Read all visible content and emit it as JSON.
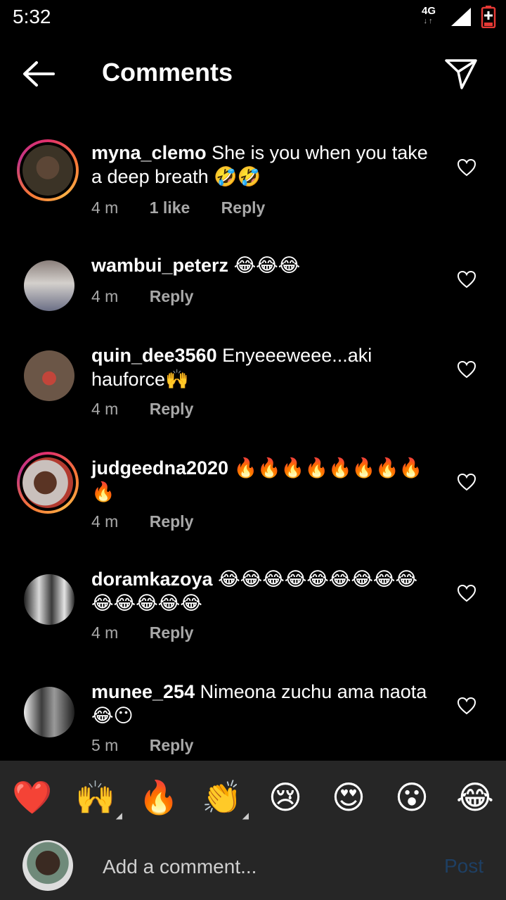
{
  "status": {
    "time": "5:32",
    "network": "4G"
  },
  "header": {
    "title": "Comments"
  },
  "comments": [
    {
      "username": "myna_clemo",
      "text": "She is you when you take a deep breath 🤣🤣",
      "time": "4 m",
      "likes": "1 like",
      "reply": "Reply",
      "story_ring": true
    },
    {
      "username": "wambui_peterz",
      "text": "😂😂😂",
      "time": "4 m",
      "reply": "Reply",
      "story_ring": false
    },
    {
      "username": "quin_dee3560",
      "text": "Enyeeeweee...aki hauforce🙌",
      "time": "4 m",
      "reply": "Reply",
      "story_ring": false
    },
    {
      "username": "judgeedna2020",
      "text": "🔥🔥🔥🔥🔥🔥🔥🔥🔥",
      "time": "4 m",
      "reply": "Reply",
      "story_ring": true
    },
    {
      "username": "doramkazoya",
      "text": "😂😂😂😂😂😂😂😂😂😂😂😂😂😂",
      "time": "4 m",
      "reply": "Reply",
      "story_ring": false
    },
    {
      "username": "munee_254",
      "text": "Nimeona zuchu ama naota 😂😶",
      "time": "5 m",
      "reply": "Reply",
      "story_ring": false
    }
  ],
  "reactions": [
    "❤️",
    "🙌",
    "🔥",
    "👏",
    "😢",
    "😍",
    "😮",
    "😂"
  ],
  "composer": {
    "placeholder": "Add a comment...",
    "post_label": "Post"
  },
  "colors": {
    "background": "#000000",
    "bar": "#262626",
    "meta": "#a8a8a8",
    "post_disabled": "#1e3f63"
  }
}
